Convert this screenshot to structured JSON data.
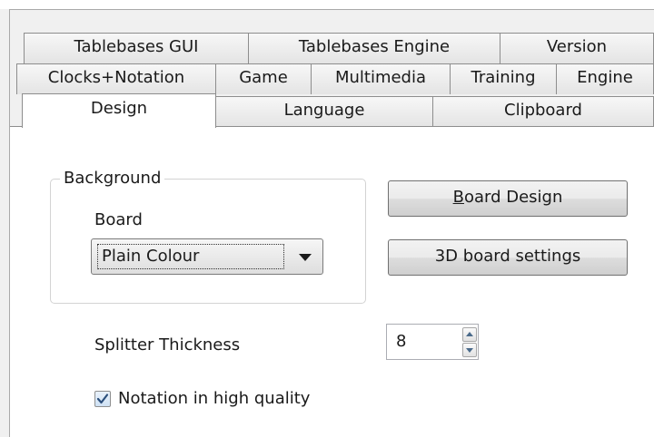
{
  "tabs": {
    "row1": [
      "Tablebases GUI",
      "Tablebases Engine",
      "Version"
    ],
    "row2": [
      "Clocks+Notation",
      "Game",
      "Multimedia",
      "Training",
      "Engine"
    ],
    "row3": [
      "Design",
      "Language",
      "Clipboard"
    ],
    "active": "Design"
  },
  "background_group": {
    "title": "Background",
    "board_label": "Board",
    "board_select_value": "Plain Colour"
  },
  "buttons": {
    "board_design_accel": "B",
    "board_design_rest": "oard Design",
    "board_settings_3d": "3D board settings"
  },
  "splitter": {
    "label": "Splitter Thickness",
    "value": "8"
  },
  "notation_hq": {
    "label": "Notation in high quality",
    "checked": true
  }
}
